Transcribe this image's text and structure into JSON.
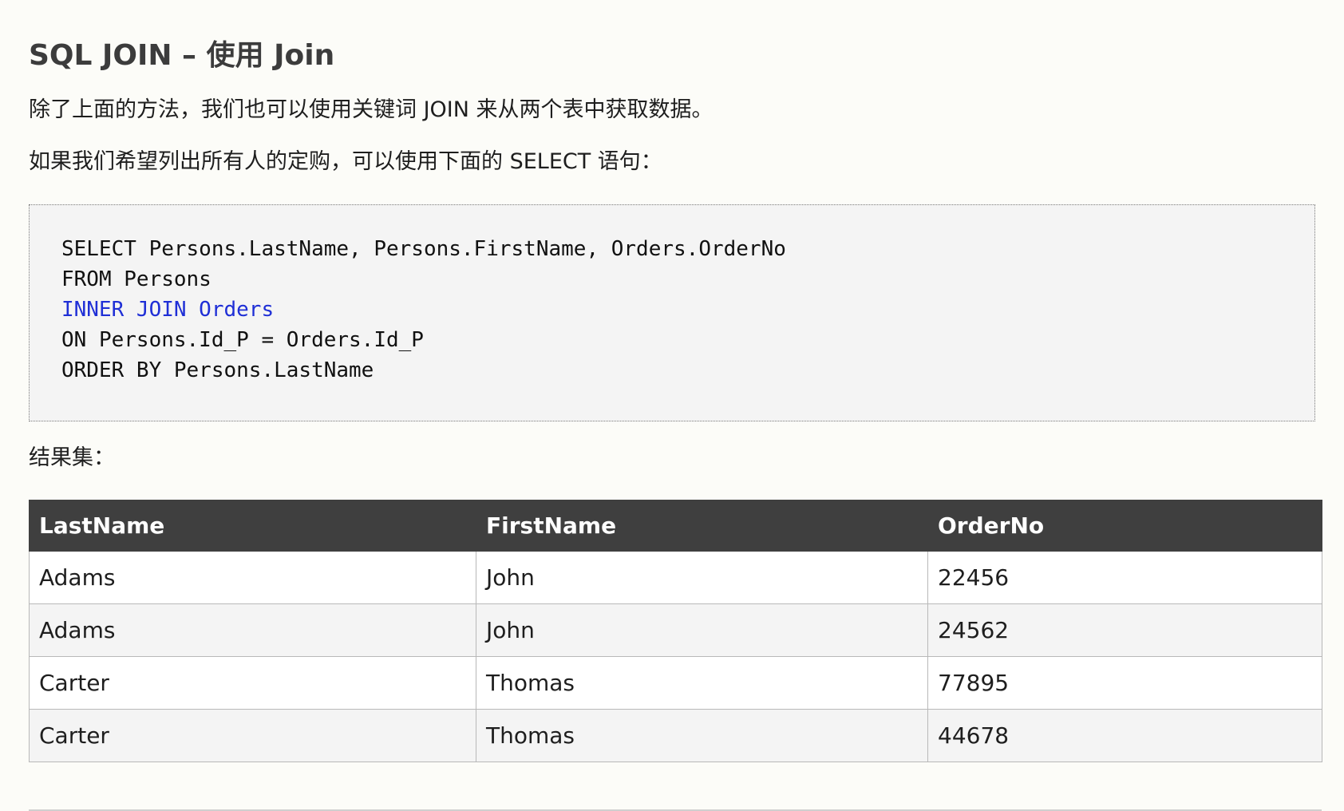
{
  "heading": "SQL JOIN – 使用 Join",
  "paragraphs": {
    "intro": "除了上面的方法，我们也可以使用关键词 JOIN 来从两个表中获取数据。",
    "select_intro": "如果我们希望列出所有人的定购，可以使用下面的 SELECT 语句：",
    "result_label": "结果集："
  },
  "code": {
    "lines": [
      "SELECT Persons.LastName, Persons.FirstName, Orders.OrderNo",
      "FROM Persons",
      "INNER JOIN Orders",
      "ON Persons.Id_P = Orders.Id_P",
      "ORDER BY Persons.LastName"
    ],
    "highlight_color": "#1f2fd6"
  },
  "table": {
    "headers": [
      "LastName",
      "FirstName",
      "OrderNo"
    ],
    "rows": [
      [
        "Adams",
        "John",
        "22456"
      ],
      [
        "Adams",
        "John",
        "24562"
      ],
      [
        "Carter",
        "Thomas",
        "77895"
      ],
      [
        "Carter",
        "Thomas",
        "44678"
      ]
    ],
    "header_bg": "#3f3f3f"
  }
}
